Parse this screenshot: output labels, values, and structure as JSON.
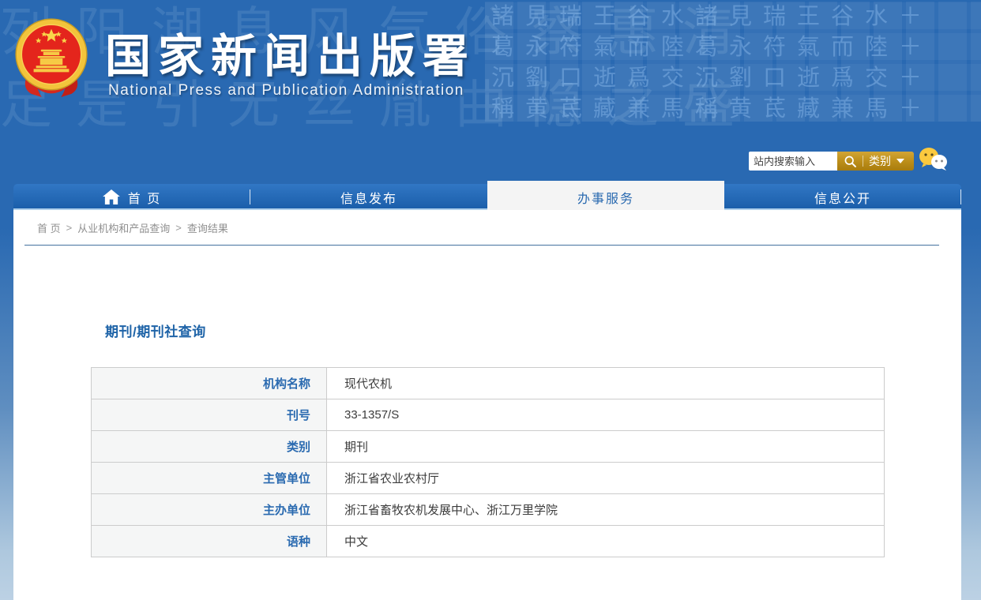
{
  "header": {
    "site_title": "国家新闻出版署",
    "site_subtitle": "National  Press and Publication Administration",
    "search": {
      "placeholder": "站内搜索输入",
      "category_label": "类别"
    },
    "watermark_calligraphy": "列阳潮息风气俗察惠清\n足是引无丝胤曲隐之盛",
    "watermark_tiles": "諸見瑞王谷水諸見瑞王谷水＋\n葛永符氣而陸葛永符氣而陸＋\n沉劉口逝爲交沉劉口逝爲交＋\n稱黄茋藏兼馬稱黄茋藏兼馬＋"
  },
  "nav": {
    "items": [
      {
        "label": "首 页",
        "active": false
      },
      {
        "label": "信息发布",
        "active": false
      },
      {
        "label": "办事服务",
        "active": true
      },
      {
        "label": "信息公开",
        "active": false
      }
    ]
  },
  "breadcrumb": {
    "separator": ">",
    "items": [
      "首 页",
      "从业机构和产品查询",
      "查询结果"
    ]
  },
  "main": {
    "title": "期刊/期刊社查询",
    "table": {
      "rows": [
        {
          "label": "机构名称",
          "value": "现代农机"
        },
        {
          "label": "刊号",
          "value": "33-1357/S"
        },
        {
          "label": "类别",
          "value": "期刊"
        },
        {
          "label": "主管单位",
          "value": "浙江省农业农村厅"
        },
        {
          "label": "主办单位",
          "value": "浙江省畜牧农机发展中心、浙江万里学院"
        },
        {
          "label": "语种",
          "value": "中文"
        }
      ]
    }
  },
  "colors": {
    "header_blue": "#2969b2",
    "accent_blue": "#2a6ab0",
    "gold": "#bb8d18",
    "emblem_red": "#e4251c",
    "emblem_gold": "#f5c63c",
    "table_border": "#cccccc",
    "label_bg": "#f5f6f6",
    "active_tab_bg": "#f4f4f4"
  }
}
